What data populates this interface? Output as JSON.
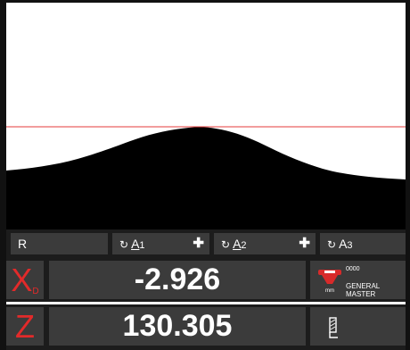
{
  "status_bar": {
    "r_label": "R",
    "a1": {
      "letter": "A",
      "index": "1"
    },
    "a2": {
      "letter": "A",
      "index": "2"
    },
    "a3": {
      "letter": "A",
      "index": "3"
    },
    "plus_symbol": "✚",
    "rotate_symbol": "↻"
  },
  "readouts": {
    "x": {
      "axis": "X",
      "sub": "D",
      "value": "-2.926"
    },
    "z": {
      "axis": "Z",
      "value": "130.305"
    }
  },
  "tool": {
    "number": "0000",
    "name": "GENERAL MASTER",
    "unit": "mm"
  },
  "colors": {
    "accent_red": "#e22a2a",
    "panel_bg": "#3b3b3b",
    "bar_bg": "#1c1c1c",
    "silhouette": "#000000"
  }
}
